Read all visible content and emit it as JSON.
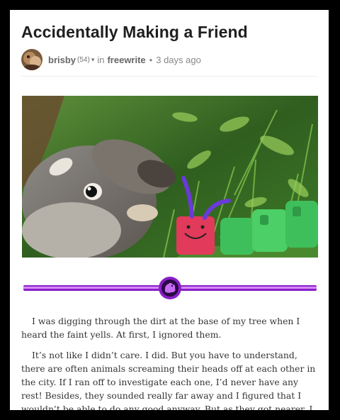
{
  "post": {
    "title": "Accidentally Making a Friend"
  },
  "meta": {
    "author": "brisby",
    "reputation": "(54)",
    "caret": "▾",
    "in_label": "in",
    "community": "freewrite",
    "separator": "•",
    "time_ago": "3 days ago"
  },
  "image": {
    "description_icon": "photo-squirrel-caterpillar"
  },
  "divider_art": {
    "icon": "squirrel-emblem-icon",
    "colors": {
      "line": "#8a1fc9",
      "line_light": "#c86bf3",
      "emblem_ring": "#2a0a44"
    }
  },
  "body": {
    "paragraphs": [
      "I was digging through the dirt at the base of my tree when I heard the faint yells. At first, I ignored them.",
      "It’s not like I didn’t care. I did. But you have to understand, there are often animals screaming their heads off at each other in the city. If I ran off to investigate each one, I’d never have any rest! Besides, they sounded really far away and I figured that I wouldn’t be able to do any good anyway. But as they got nearer, I could more distinctly hear..."
    ]
  },
  "colors": {
    "text": "#333333",
    "title": "#1f1f1f",
    "muted": "#777777"
  }
}
